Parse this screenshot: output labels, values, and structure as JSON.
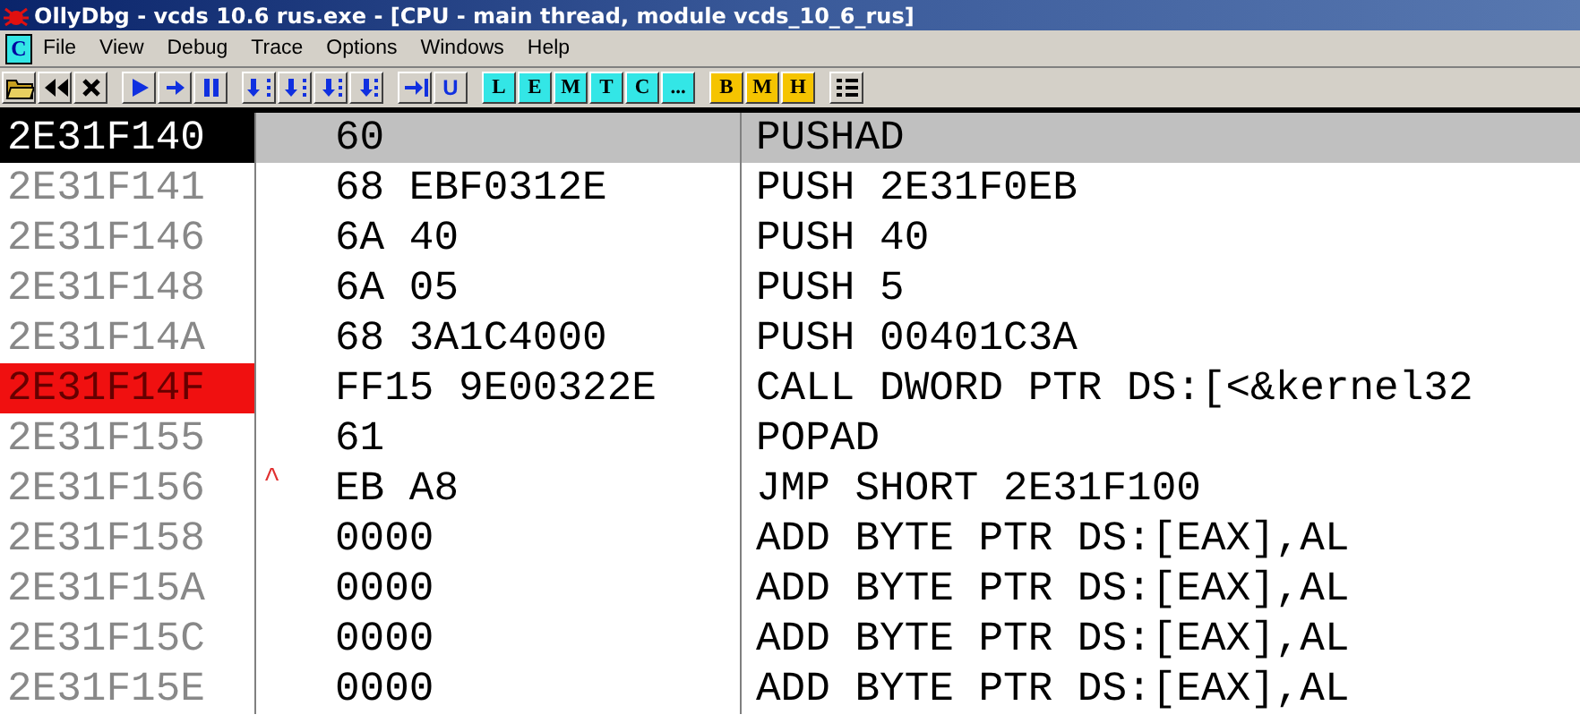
{
  "window": {
    "title": "OllyDbg - vcds 10.6 rus.exe - [CPU - main thread, module vcds_10_6_rus]"
  },
  "menu": {
    "child_icon": "C",
    "items": [
      "File",
      "View",
      "Debug",
      "Trace",
      "Options",
      "Windows",
      "Help"
    ]
  },
  "toolbar": {
    "text_buttons": [
      {
        "label": "U",
        "color": "#d4d0c8"
      }
    ],
    "window_buttons": [
      {
        "label": "L",
        "color": "#33e6e6"
      },
      {
        "label": "E",
        "color": "#33e6e6"
      },
      {
        "label": "M",
        "color": "#33e6e6"
      },
      {
        "label": "T",
        "color": "#33e6e6"
      },
      {
        "label": "C",
        "color": "#33e6e6"
      },
      {
        "label": "...",
        "color": "#33e6e6"
      }
    ],
    "breakpoint_buttons": [
      {
        "label": "B",
        "color": "#f5c400"
      },
      {
        "label": "M",
        "color": "#f5c400"
      },
      {
        "label": "H",
        "color": "#f5c400"
      }
    ]
  },
  "disassembly": {
    "rows": [
      {
        "address": "2E31F140",
        "hex": "60",
        "disasm": "PUSHAD",
        "selected": true,
        "breakpoint": false
      },
      {
        "address": "2E31F141",
        "hex": "68 EBF0312E",
        "disasm": "PUSH 2E31F0EB",
        "selected": false,
        "breakpoint": false
      },
      {
        "address": "2E31F146",
        "hex": "6A 40",
        "disasm": "PUSH 40",
        "selected": false,
        "breakpoint": false
      },
      {
        "address": "2E31F148",
        "hex": "6A 05",
        "disasm": "PUSH 5",
        "selected": false,
        "breakpoint": false
      },
      {
        "address": "2E31F14A",
        "hex": "68 3A1C4000",
        "disasm": "PUSH 00401C3A",
        "selected": false,
        "breakpoint": false
      },
      {
        "address": "2E31F14F",
        "hex": "FF15 9E00322E",
        "disasm": "CALL DWORD PTR DS:[<&kernel32",
        "selected": false,
        "breakpoint": true
      },
      {
        "address": "2E31F155",
        "hex": "61",
        "disasm": "POPAD",
        "selected": false,
        "breakpoint": false
      },
      {
        "address": "2E31F156",
        "jump_mark": "^",
        "hex": "EB A8",
        "disasm": "JMP SHORT 2E31F100",
        "selected": false,
        "breakpoint": false
      },
      {
        "address": "2E31F158",
        "hex": "0000",
        "disasm": "ADD BYTE PTR DS:[EAX],AL",
        "selected": false,
        "breakpoint": false
      },
      {
        "address": "2E31F15A",
        "hex": "0000",
        "disasm": "ADD BYTE PTR DS:[EAX],AL",
        "selected": false,
        "breakpoint": false
      },
      {
        "address": "2E31F15C",
        "hex": "0000",
        "disasm": "ADD BYTE PTR DS:[EAX],AL",
        "selected": false,
        "breakpoint": false
      },
      {
        "address": "2E31F15E",
        "hex": "0000",
        "disasm": "ADD BYTE PTR DS:[EAX],AL",
        "selected": false,
        "breakpoint": false
      }
    ]
  }
}
